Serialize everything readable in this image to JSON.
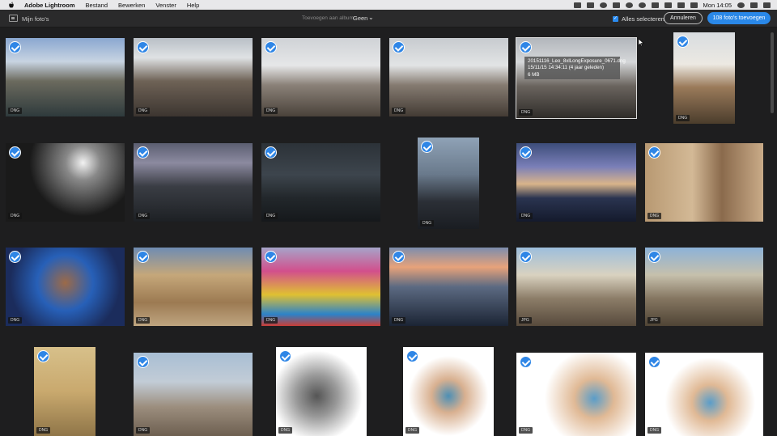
{
  "menubar": {
    "app_name": "Adobe Lightroom",
    "menus": [
      "Bestand",
      "Bewerken",
      "Venster",
      "Help"
    ],
    "clock": "Mon 14:05"
  },
  "toolbar": {
    "my_photos": "Mijn foto's",
    "add_to_album_label": "Toevoegen aan album",
    "album_value": "Geen",
    "select_all_label": "Alles selecteren",
    "cancel_label": "Annuleren",
    "add_photos_label": "108 foto's toevoegen"
  },
  "colors": {
    "accent": "#2f86e6",
    "background": "#1e1e1f"
  },
  "tooltip": {
    "filename": "20151116_Leo_8xlLongExposure_0671.dng",
    "date": "15/11/15 14:34:11 (4 jaar geleden)",
    "size": "6 MB"
  },
  "photos": [
    {
      "subject": "industrial river panorama",
      "format": "DNG"
    },
    {
      "subject": "city rooftops cloudy",
      "format": "DNG"
    },
    {
      "subject": "city skyline with spire",
      "format": "DNG"
    },
    {
      "subject": "city skyline with spire 2",
      "format": "DNG"
    },
    {
      "subject": "rooftop long exposure",
      "format": "DNG"
    },
    {
      "subject": "woman sitting portrait",
      "format": "DNG"
    },
    {
      "subject": "ballerina silhouette",
      "format": "DNG"
    },
    {
      "subject": "bridge at dusk",
      "format": "DNG"
    },
    {
      "subject": "dark skyline water",
      "format": "DNG"
    },
    {
      "subject": "bridge portrait",
      "format": "DNG"
    },
    {
      "subject": "city night reflection",
      "format": "DNG"
    },
    {
      "subject": "old man with scarf",
      "format": "DNG"
    },
    {
      "subject": "woman in blue sari",
      "format": "DNG"
    },
    {
      "subject": "palace facade",
      "format": "DNG"
    },
    {
      "subject": "colored powder bowls",
      "format": "DNG"
    },
    {
      "subject": "lake town at sunset",
      "format": "DNG"
    },
    {
      "subject": "men sitting together",
      "format": "JPG"
    },
    {
      "subject": "men sitting together 2",
      "format": "JPG"
    },
    {
      "subject": "doorway window",
      "format": "DNG"
    },
    {
      "subject": "mosque dome",
      "format": "DNG"
    },
    {
      "subject": "boy black and white",
      "format": "DNG"
    },
    {
      "subject": "boy drawing",
      "format": "DNG"
    },
    {
      "subject": "boy on green chair",
      "format": "DNG"
    },
    {
      "subject": "boy on green chair 2",
      "format": "DNG"
    }
  ]
}
